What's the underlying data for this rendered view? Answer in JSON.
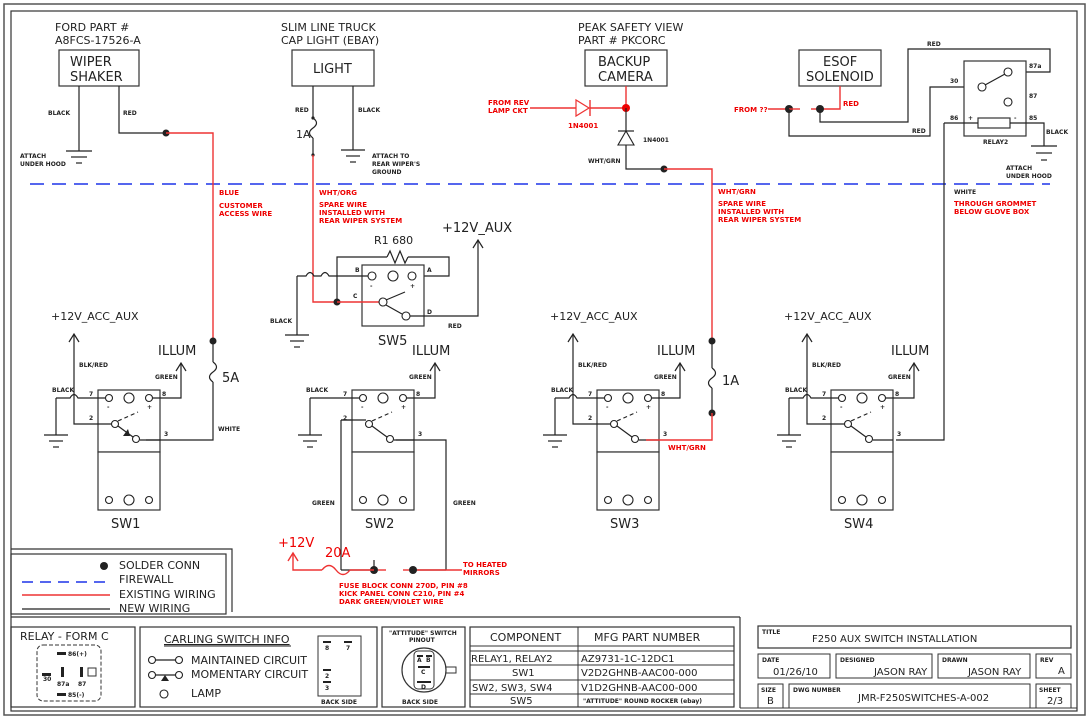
{
  "components": {
    "wiper_shaker": {
      "note1": "FORD PART #",
      "note2": "A8FCS-17526-A",
      "label1": "WIPER",
      "label2": "SHAKER",
      "wire_left": "BLACK",
      "wire_right": "RED",
      "ground_note1": "ATTACH",
      "ground_note2": "UNDER HOOD",
      "down_wire": "BLUE",
      "down_note1": "CUSTOMER",
      "down_note2": "ACCESS WIRE"
    },
    "light": {
      "note1": "SLIM LINE TRUCK",
      "note2": "CAP LIGHT (EBAY)",
      "label": "LIGHT",
      "wire_left": "RED",
      "wire_right": "BLACK",
      "fuse": "1A",
      "ground_note1": "ATTACH TO",
      "ground_note2": "REAR WIPER'S",
      "ground_note3": "GROUND",
      "down_wire": "WHT/ORG",
      "down_note1": "SPARE WIRE",
      "down_note2": "INSTALLED WITH",
      "down_note3": "REAR WIPER SYSTEM"
    },
    "backup_camera": {
      "note1": "PEAK SAFETY VIEW",
      "note2": "PART # PKCORC",
      "label1": "BACKUP",
      "label2": "CAMERA",
      "from_note1": "FROM REV",
      "from_note2": "LAMP CKT",
      "diode1": "1N4001",
      "diode2": "1N4001",
      "wire": "WHT/GRN",
      "down_wire": "WHT/GRN",
      "down_note1": "SPARE WIRE",
      "down_note2": "INSTALLED WITH",
      "down_note3": "REAR WIPER SYSTEM"
    },
    "esof": {
      "label1": "ESOF",
      "label2": "SOLENOID",
      "from": "FROM ??",
      "wire_sol": "RED",
      "wire_top": "RED",
      "wire_bottom": "RED"
    },
    "relay2": {
      "name": "RELAY2",
      "p30": "30",
      "p87a": "87a",
      "p87": "87",
      "p86": "86",
      "p85": "85",
      "plus": "+",
      "minus": "-",
      "ground_wire": "BLACK",
      "ground_note1": "ATTACH",
      "ground_note2": "UNDER HOOD",
      "down_wire": "WHITE",
      "down_note1": "THROUGH GROMMET",
      "down_note2": "BELOW GLOVE BOX"
    },
    "sw5": {
      "name": "SW5",
      "r1": "R1  680",
      "supply": "+12V_AUX",
      "pB": "B",
      "pA": "A",
      "pC": "C",
      "pD": "D",
      "ground_wire": "BLACK",
      "out_wire": "RED",
      "minus": "-",
      "plus": "+"
    },
    "sw1": {
      "name": "SW1",
      "supply": "+12V_ACC_AUX",
      "illum": "ILLUM",
      "supply_wire": "BLK/RED",
      "illum_wire": "GREEN",
      "ground_wire": "BLACK",
      "out_wire": "WHITE",
      "fuse": "5A",
      "p7": "7",
      "p8": "8",
      "p2": "2",
      "p3": "3"
    },
    "sw2": {
      "name": "SW2",
      "illum": "ILLUM",
      "illum_wire": "GREEN",
      "ground_wire": "BLACK",
      "left_wire": "GREEN",
      "right_wire": "GREEN",
      "p7": "7",
      "p8": "8",
      "p2": "2",
      "p3": "3",
      "supply": "+12V",
      "fuse": "20A",
      "to_note1": "TO HEATED",
      "to_note2": "MIRRORS",
      "fuse_note1": "FUSE BLOCK CONN 270D, PIN #8",
      "fuse_note2": "KICK PANEL CONN C210, PIN #4",
      "fuse_note3": "DARK GREEN/VIOLET WIRE"
    },
    "sw3": {
      "name": "SW3",
      "supply": "+12V_ACC_AUX",
      "illum": "ILLUM",
      "supply_wire": "BLK/RED",
      "illum_wire": "GREEN",
      "ground_wire": "BLACK",
      "out_wire": "WHT/GRN",
      "fuse": "1A",
      "p7": "7",
      "p8": "8",
      "p2": "2",
      "p3": "3"
    },
    "sw4": {
      "name": "SW4",
      "supply": "+12V_ACC_AUX",
      "illum": "ILLUM",
      "supply_wire": "BLK/RED",
      "illum_wire": "GREEN",
      "ground_wire": "BLACK",
      "p7": "7",
      "p8": "8",
      "p2": "2",
      "p3": "3"
    }
  },
  "legend": {
    "items": [
      {
        "label": "SOLDER CONN"
      },
      {
        "label": "FIREWALL"
      },
      {
        "label": "EXISTING WIRING"
      },
      {
        "label": "NEW WIRING"
      }
    ],
    "colors": {
      "firewall": "#5566ee",
      "existing": "#e33333",
      "new": "#222222"
    }
  },
  "relay_info": {
    "title": "RELAY - FORM C",
    "p86": "86(+)",
    "p30": "30",
    "p87a": "87a",
    "p87": "87",
    "p85": "85(-)"
  },
  "carling_info": {
    "title": "CARLING SWITCH INFO",
    "items": [
      "MAINTAINED CIRCUIT",
      "MOMENTARY CIRCUIT",
      "LAMP"
    ],
    "pins": [
      "8",
      "7",
      "2",
      "3"
    ],
    "back": "BACK SIDE"
  },
  "attitude_info": {
    "title1": "\"ATTITUDE\" SWITCH",
    "title2": "PINOUT",
    "pins": [
      "A",
      "B",
      "C",
      "D"
    ],
    "back": "BACK SIDE"
  },
  "parts_table": {
    "headers": [
      "COMPONENT",
      "MFG PART NUMBER"
    ],
    "rows": [
      [
        "RELAY1, RELAY2",
        "AZ9731-1C-12DC1"
      ],
      [
        "SW1",
        "V2D2GHNB-AAC00-000"
      ],
      [
        "SW2, SW3, SW4",
        "V1D2GHNB-AAC00-000"
      ],
      [
        "SW5",
        "\"ATTITUDE\" ROUND ROCKER (ebay)"
      ]
    ]
  },
  "title_block": {
    "title_label": "TITLE",
    "title": "F250 AUX SWITCH INSTALLATION",
    "date_label": "DATE",
    "date": "01/26/10",
    "designed_label": "DESIGNED",
    "designed": "JASON RAY",
    "drawn_label": "DRAWN",
    "drawn": "JASON RAY",
    "rev_label": "REV",
    "rev": "A",
    "size_label": "SIZE",
    "size": "B",
    "dwg_label": "DWG NUMBER",
    "dwg": "JMR-F250SWITCHES-A-002",
    "sheet_label": "SHEET",
    "sheet": "2/3"
  }
}
